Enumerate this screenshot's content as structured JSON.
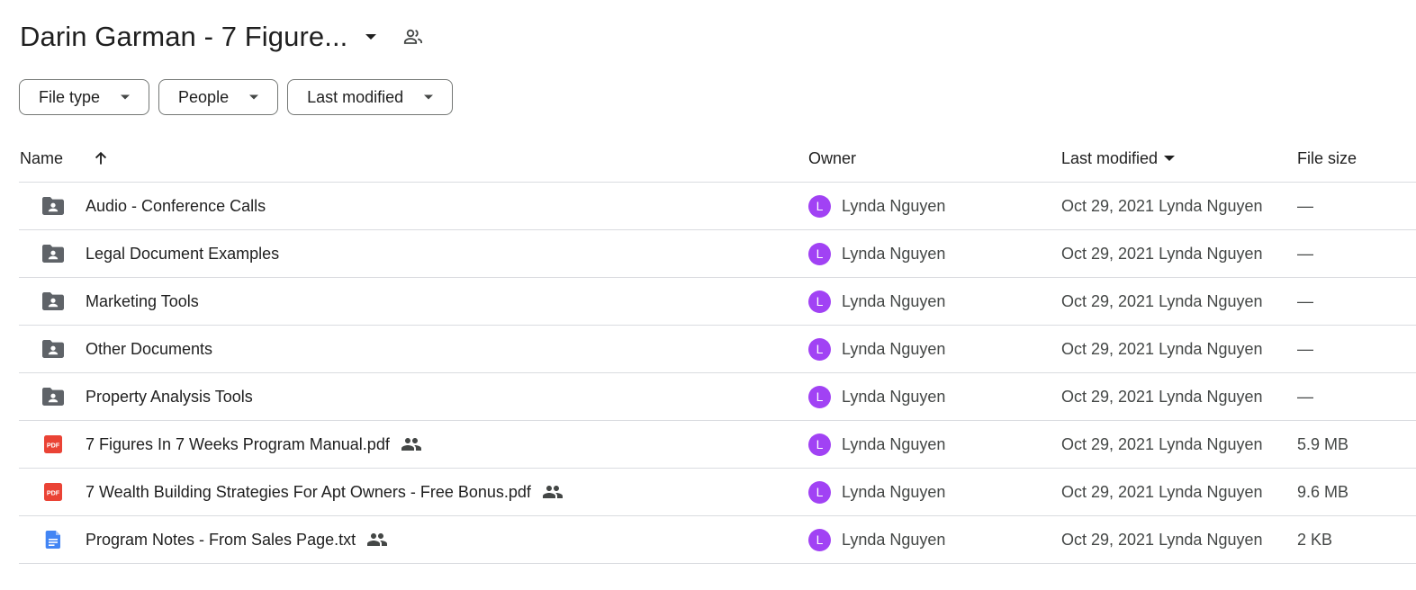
{
  "header": {
    "title": "Darin Garman - 7 Figure...",
    "dropdown_icon": "arrow-drop-down-icon",
    "shared_icon": "people-outline-icon"
  },
  "filters": [
    {
      "label": "File type"
    },
    {
      "label": "People"
    },
    {
      "label": "Last modified"
    }
  ],
  "columns": {
    "name": "Name",
    "owner": "Owner",
    "last_modified": "Last modified",
    "file_size": "File size",
    "sort_icon": "arrow-upward-icon"
  },
  "files": [
    {
      "type": "shared-folder",
      "name": "Audio - Conference Calls",
      "shared": false,
      "owner_initial": "L",
      "owner": "Lynda Nguyen",
      "modified": "Oct 29, 2021 Lynda Nguyen",
      "size": "—"
    },
    {
      "type": "shared-folder",
      "name": "Legal Document Examples",
      "shared": false,
      "owner_initial": "L",
      "owner": "Lynda Nguyen",
      "modified": "Oct 29, 2021 Lynda Nguyen",
      "size": "—"
    },
    {
      "type": "shared-folder",
      "name": "Marketing Tools",
      "shared": false,
      "owner_initial": "L",
      "owner": "Lynda Nguyen",
      "modified": "Oct 29, 2021 Lynda Nguyen",
      "size": "—"
    },
    {
      "type": "shared-folder",
      "name": "Other Documents",
      "shared": false,
      "owner_initial": "L",
      "owner": "Lynda Nguyen",
      "modified": "Oct 29, 2021 Lynda Nguyen",
      "size": "—"
    },
    {
      "type": "shared-folder",
      "name": "Property Analysis Tools",
      "shared": false,
      "owner_initial": "L",
      "owner": "Lynda Nguyen",
      "modified": "Oct 29, 2021 Lynda Nguyen",
      "size": "—"
    },
    {
      "type": "pdf",
      "name": "7 Figures In 7 Weeks Program Manual.pdf",
      "shared": true,
      "owner_initial": "L",
      "owner": "Lynda Nguyen",
      "modified": "Oct 29, 2021 Lynda Nguyen",
      "size": "5.9 MB"
    },
    {
      "type": "pdf",
      "name": "7 Wealth Building Strategies For Apt Owners - Free Bonus.pdf",
      "shared": true,
      "owner_initial": "L",
      "owner": "Lynda Nguyen",
      "modified": "Oct 29, 2021 Lynda Nguyen",
      "size": "9.6 MB"
    },
    {
      "type": "doc",
      "name": "Program Notes - From Sales Page.txt",
      "shared": true,
      "owner_initial": "L",
      "owner": "Lynda Nguyen",
      "modified": "Oct 29, 2021 Lynda Nguyen",
      "size": "2 KB"
    }
  ],
  "colors": {
    "folder": "#5f6368",
    "pdf": "#ea4335",
    "doc": "#4285f4",
    "avatar": "#a142f4",
    "divider": "#dadce0"
  }
}
